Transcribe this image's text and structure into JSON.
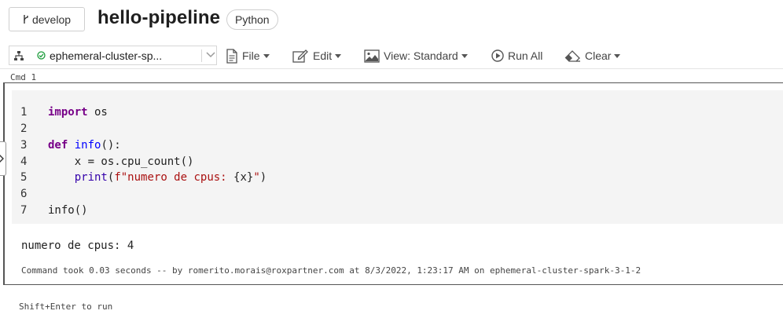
{
  "header": {
    "branch_label": "develop",
    "notebook_title": "hello-pipeline",
    "language": "Python"
  },
  "toolbar": {
    "cluster_name": "ephemeral-cluster-sp...",
    "file_label": "File",
    "edit_label": "Edit",
    "view_label": "View: Standard",
    "run_all_label": "Run All",
    "clear_label": "Clear"
  },
  "colors": {
    "accent_green": "#1a9c3a",
    "keyword": "#770088",
    "function": "#0000ff",
    "string": "#aa1111"
  },
  "cell": {
    "cmd_label": "Cmd 1",
    "lines": [
      {
        "n": "1",
        "parts": [
          {
            "t": "import",
            "c": "kw"
          },
          {
            "t": " os",
            "c": ""
          }
        ]
      },
      {
        "n": "2",
        "parts": []
      },
      {
        "n": "3",
        "parts": [
          {
            "t": "def",
            "c": "kw"
          },
          {
            "t": " ",
            "c": ""
          },
          {
            "t": "info",
            "c": "fn"
          },
          {
            "t": "():",
            "c": ""
          }
        ]
      },
      {
        "n": "4",
        "parts": [
          {
            "t": "    x = os.cpu_count()",
            "c": ""
          }
        ]
      },
      {
        "n": "5",
        "parts": [
          {
            "t": "    ",
            "c": ""
          },
          {
            "t": "print",
            "c": "bi"
          },
          {
            "t": "(",
            "c": ""
          },
          {
            "t": "f\"numero de cpus: ",
            "c": "str"
          },
          {
            "t": "{x}",
            "c": ""
          },
          {
            "t": "\"",
            "c": "str"
          },
          {
            "t": ")",
            "c": ""
          }
        ]
      },
      {
        "n": "6",
        "parts": []
      },
      {
        "n": "7",
        "parts": [
          {
            "t": "info()",
            "c": ""
          }
        ]
      }
    ],
    "output": "numero de cpus: 4",
    "command_took": "Command took 0.03 seconds -- by romerito.morais@roxpartner.com at 8/3/2022, 1:23:17 AM on ephemeral-cluster-spark-3-1-2"
  },
  "footer": {
    "hint": "Shift+Enter to run"
  }
}
